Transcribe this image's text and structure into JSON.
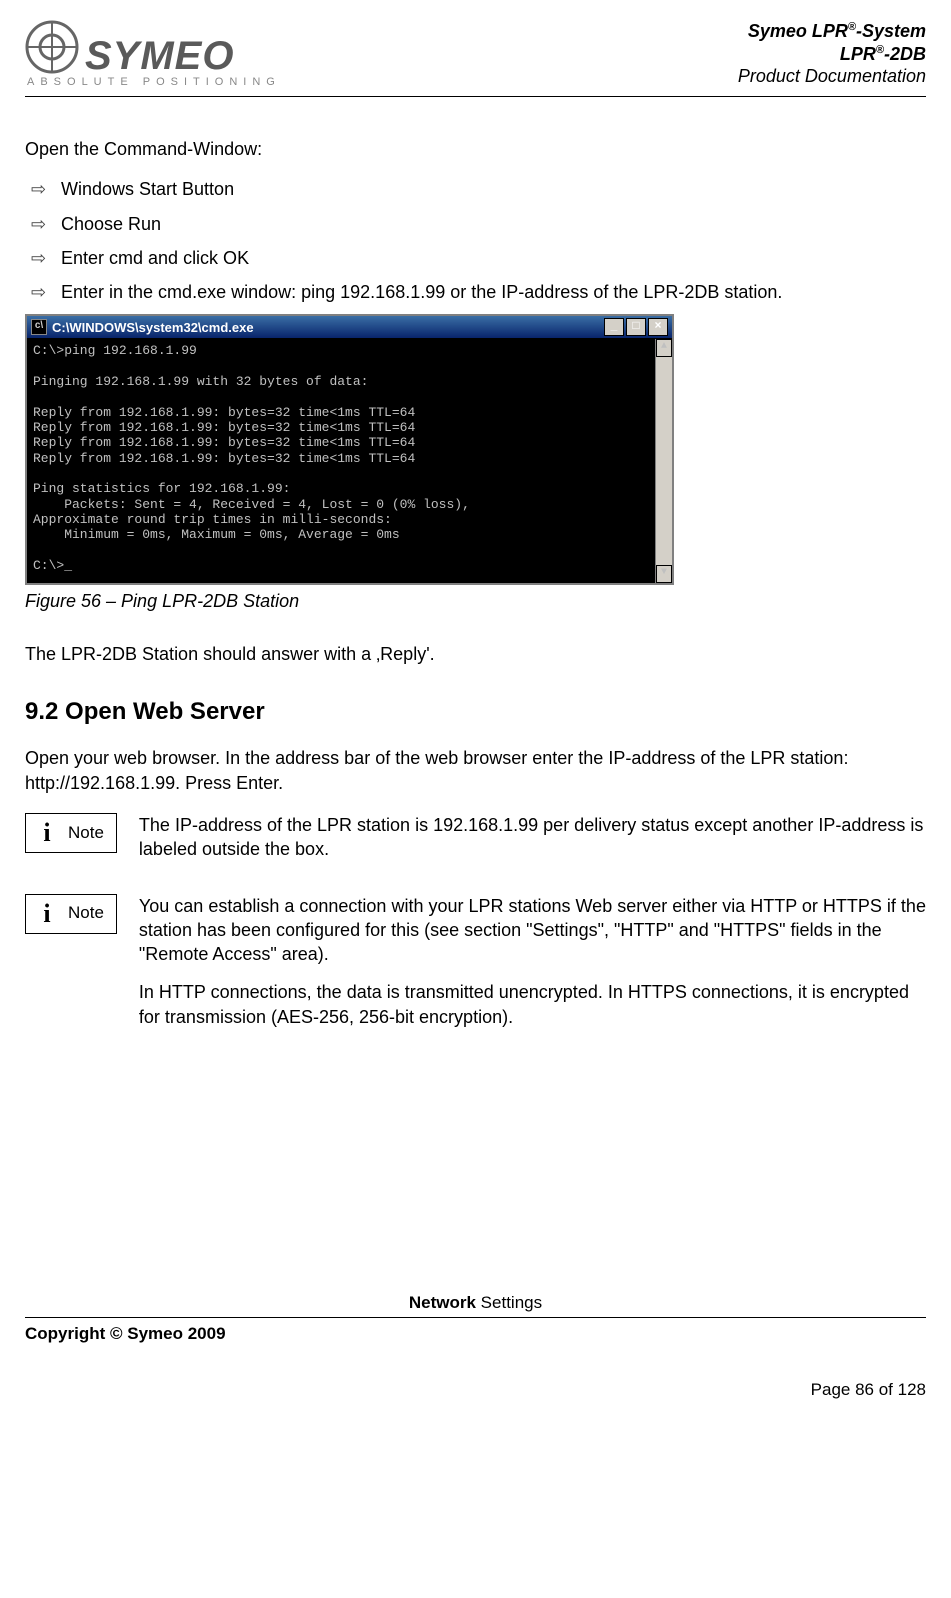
{
  "header": {
    "logo_name": "SYMEO",
    "logo_tag": "ABSOLUTE POSITIONING",
    "title_line1_pre": "Symeo LPR",
    "title_line1_sup": "®",
    "title_line1_post": "-System",
    "title_line2_pre": "LPR",
    "title_line2_sup": "®",
    "title_line2_post": "-2DB",
    "title_line3": "Product Documentation"
  },
  "intro_para": "Open the Command-Window:",
  "bullets": [
    "Windows Start Button",
    "Choose Run",
    "Enter cmd and click OK",
    "Enter in the cmd.exe window: ping 192.168.1.99 or the IP-address of the LPR-2DB station."
  ],
  "cmd": {
    "title": "C:\\WINDOWS\\system32\\cmd.exe",
    "body": "C:\\>ping 192.168.1.99\n\nPinging 192.168.1.99 with 32 bytes of data:\n\nReply from 192.168.1.99: bytes=32 time<1ms TTL=64\nReply from 192.168.1.99: bytes=32 time<1ms TTL=64\nReply from 192.168.1.99: bytes=32 time<1ms TTL=64\nReply from 192.168.1.99: bytes=32 time<1ms TTL=64\n\nPing statistics for 192.168.1.99:\n    Packets: Sent = 4, Received = 4, Lost = 0 (0% loss),\nApproximate round trip times in milli-seconds:\n    Minimum = 0ms, Maximum = 0ms, Average = 0ms\n\nC:\\>_"
  },
  "figure_caption": "Figure 56 – Ping LPR-2DB Station",
  "reply_para": "The LPR-2DB Station should answer with a ‚Reply'.",
  "section_heading": "9.2    Open Web Server",
  "section_para": "Open your web browser. In the address bar of the web browser enter the IP-address of the LPR station: http://192.168.1.99. Press Enter.",
  "notes": [
    {
      "label": "Note",
      "paras": [
        "The IP-address of the LPR station is 192.168.1.99 per delivery status except another IP-address is labeled outside the box."
      ]
    },
    {
      "label": "Note",
      "paras": [
        "You can establish a connection with your LPR stations Web server either via HTTP or HTTPS if the station has been configured for this (see section \"Settings\", \"HTTP\" and \"HTTPS\" fields in the \"Remote Access\" area).",
        "In HTTP connections, the data is transmitted unencrypted. In HTTPS connections, it is encrypted for transmission (AES-256, 256-bit encryption)."
      ]
    }
  ],
  "footer": {
    "section_label_bold": "Network",
    "section_label_rest": " Settings",
    "copyright": "Copyright © Symeo 2009",
    "page": "Page 86 of 128"
  }
}
